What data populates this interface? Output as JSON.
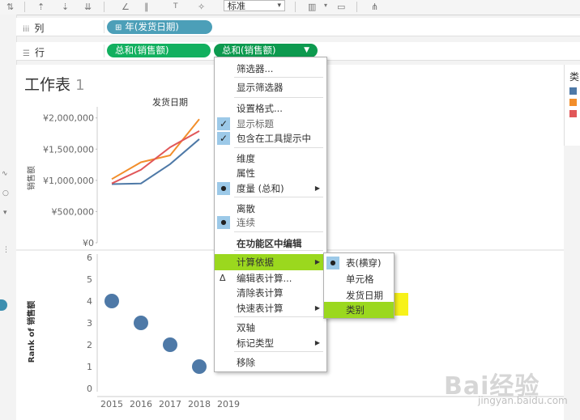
{
  "toolbar": {
    "standard_select": "标准"
  },
  "shelves": {
    "columns": {
      "label": "列",
      "pills": [
        "年(发货日期)"
      ]
    },
    "rows": {
      "label": "行",
      "pills": [
        "总和(销售额)",
        "总和(销售额)"
      ]
    }
  },
  "worksheet": {
    "title_text": "工作表",
    "title_num": "1"
  },
  "legend": {
    "title_partial": "类",
    "colors": [
      "#4e79a7",
      "#f28e2b",
      "#e15759"
    ]
  },
  "chart_data": [
    {
      "type": "line",
      "title": "发货日期",
      "ylabel": "销售额",
      "x": [
        "2015",
        "2016",
        "2017",
        "2018"
      ],
      "ylim": [
        0,
        2100000
      ],
      "yticks": [
        0,
        500000,
        1000000,
        1500000,
        2000000
      ],
      "ytick_labels": [
        "¥0",
        "¥500,000",
        "¥1,000,000",
        "¥1,500,000",
        "¥2,000,000"
      ],
      "series": [
        {
          "color": "#4e79a7",
          "values": [
            940000,
            950000,
            1260000,
            1660000
          ]
        },
        {
          "color": "#f28e2b",
          "values": [
            1020000,
            1290000,
            1400000,
            1980000
          ]
        },
        {
          "color": "#e15759",
          "values": [
            950000,
            1170000,
            1530000,
            1790000
          ]
        }
      ]
    },
    {
      "type": "scatter",
      "ylabel": "Rank of 销售额",
      "x": [
        "2015",
        "2016",
        "2017",
        "2018",
        "2019"
      ],
      "ylim": [
        0,
        6
      ],
      "yticks": [
        0,
        1,
        2,
        3,
        4,
        5,
        6
      ],
      "points": [
        {
          "x": "2015",
          "y": 4
        },
        {
          "x": "2016",
          "y": 3
        },
        {
          "x": "2017",
          "y": 2
        },
        {
          "x": "2018",
          "y": 1
        }
      ],
      "color": "#4e79a7"
    }
  ],
  "context_menu": {
    "items": [
      {
        "label": "筛选器...",
        "mark": ""
      },
      {
        "label": "显示筛选器",
        "mark": ""
      },
      {
        "label": "设置格式...",
        "mark": ""
      },
      {
        "label": "显示标题",
        "mark": "check"
      },
      {
        "label": "包含在工具提示中",
        "mark": "check"
      },
      {
        "label": "维度",
        "mark": ""
      },
      {
        "label": "属性",
        "mark": ""
      },
      {
        "label": "度量 (总和)",
        "mark": "dot",
        "submenu": true
      },
      {
        "label": "离散",
        "mark": ""
      },
      {
        "label": "连续",
        "mark": "dot"
      },
      {
        "label": "在功能区中编辑",
        "mark": ""
      },
      {
        "label": "计算依据",
        "mark": "",
        "submenu": true,
        "highlighted": true
      },
      {
        "label": "编辑表计算...",
        "mark": "delta"
      },
      {
        "label": "清除表计算",
        "mark": ""
      },
      {
        "label": "快速表计算",
        "mark": "",
        "submenu": true
      },
      {
        "label": "双轴",
        "mark": ""
      },
      {
        "label": "标记类型",
        "mark": "",
        "submenu": true
      },
      {
        "label": "移除",
        "mark": ""
      }
    ]
  },
  "compute_submenu": {
    "items": [
      {
        "label": "表(横穿)",
        "mark": "dot"
      },
      {
        "label": "单元格",
        "mark": ""
      },
      {
        "label": "发货日期",
        "mark": ""
      },
      {
        "label": "类别",
        "mark": "",
        "highlighted": true
      }
    ]
  },
  "watermark": {
    "text": "Bai经验",
    "url": "jingyan.baidu.com"
  }
}
